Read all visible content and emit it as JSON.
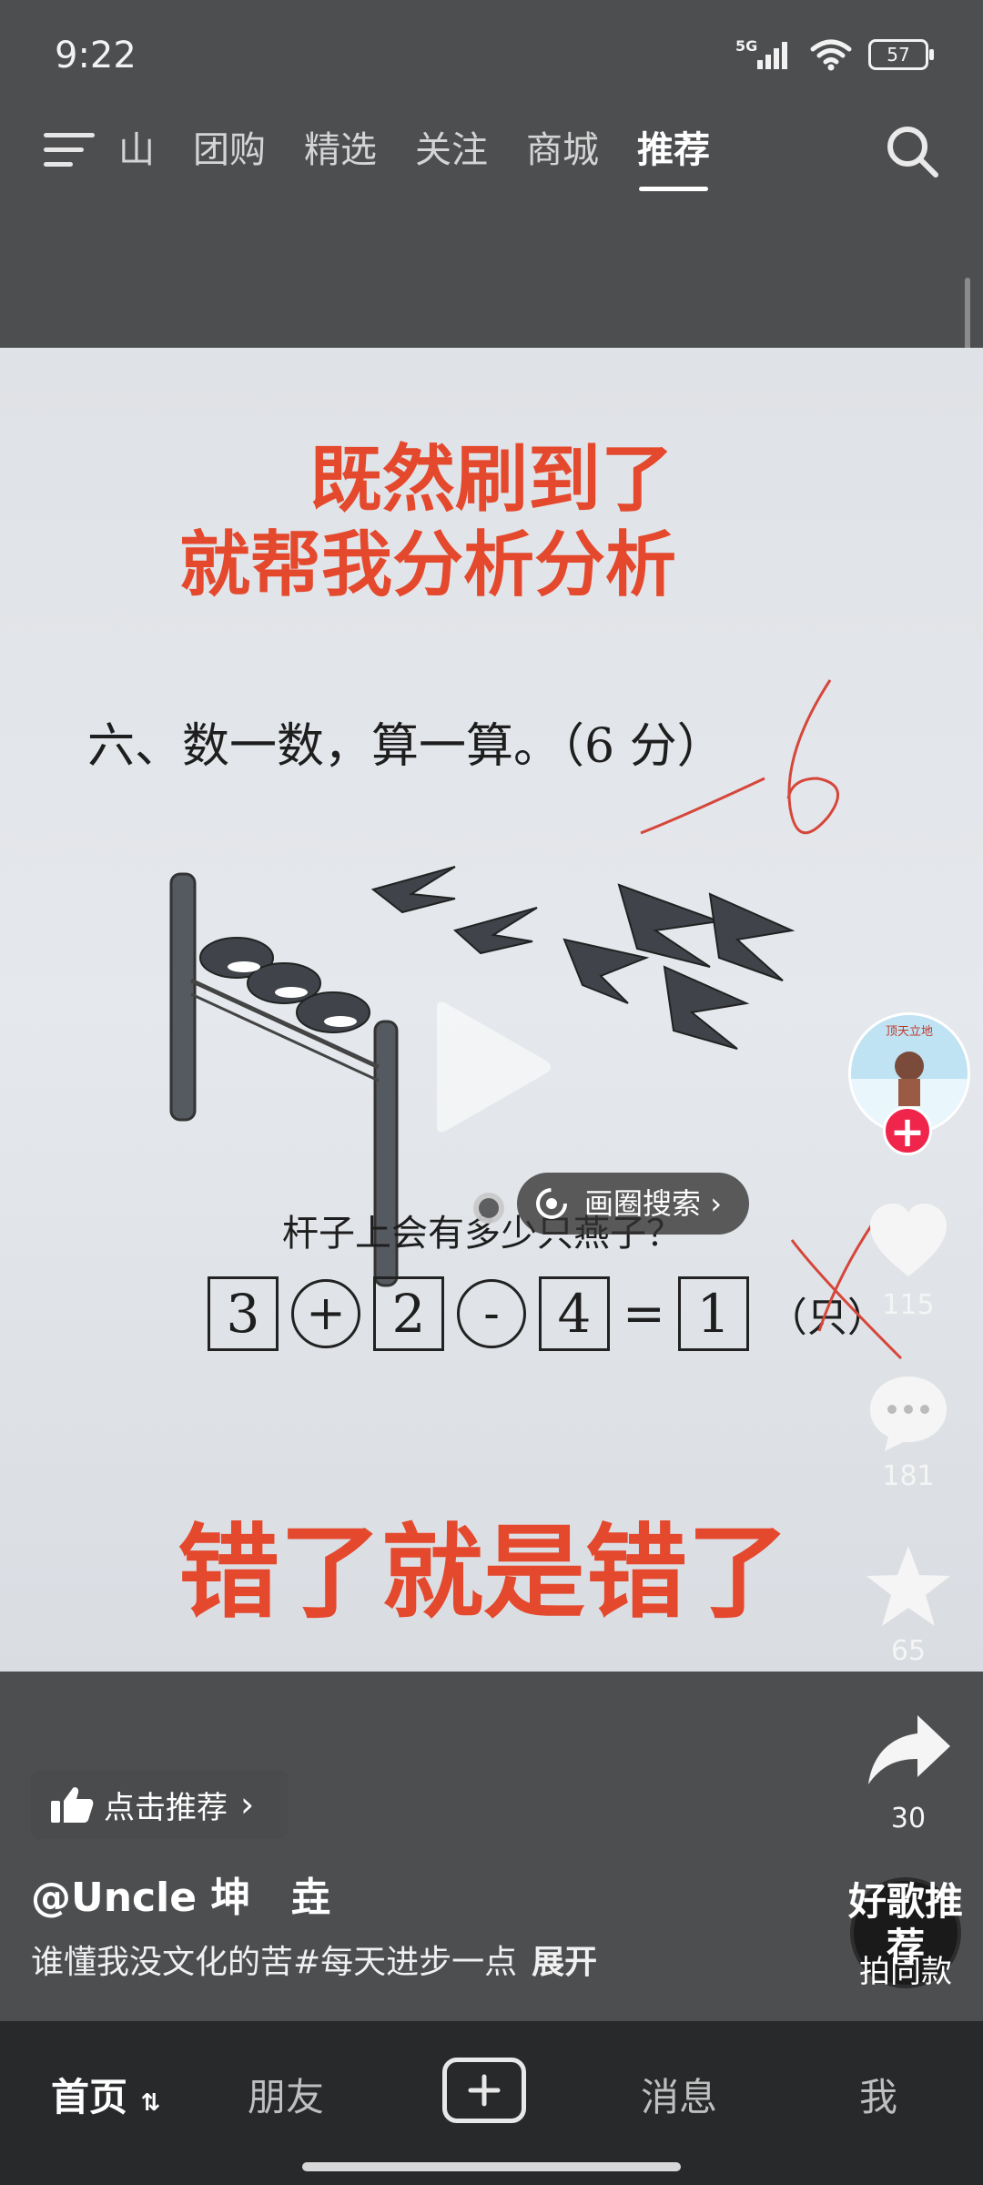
{
  "status_bar": {
    "time": "9:22",
    "network": "5G",
    "battery": "57"
  },
  "top_nav": {
    "tabs": [
      {
        "label": "山"
      },
      {
        "label": "团购"
      },
      {
        "label": "精选"
      },
      {
        "label": "关注"
      },
      {
        "label": "商城"
      },
      {
        "label": "推荐"
      }
    ],
    "active_tab": "推荐"
  },
  "video": {
    "headline_line1": "既然刷到了",
    "headline_line2": "就帮我分析分析",
    "question": "六、数一数，算一算。（6 分）",
    "score_mark": "-6",
    "sub_question": "杆子上会有多少只燕子？",
    "equation": {
      "n1": "3",
      "op1": "+",
      "n2": "2",
      "op2": "-",
      "n3": "4",
      "eq": "=",
      "result": "1",
      "unit": "（只）"
    },
    "bottom_headline": "错了就是错了",
    "circle_search_label": "画圈搜索",
    "accent_color": "#e4492e"
  },
  "right_rail": {
    "avatar_text": "顶天立地",
    "likes": "115",
    "comments": "181",
    "favorites": "65",
    "shares": "30"
  },
  "post": {
    "recommend_label": "点击推荐",
    "username": "@Uncle 坤　垚",
    "caption": "谁懂我没文化的苦#每天进步一点",
    "caption_more": "展开",
    "music_label": "好歌推荐",
    "music_sub": "拍同款"
  },
  "bottom_nav": {
    "items": [
      "首页",
      "朋友",
      "消息",
      "我"
    ]
  }
}
